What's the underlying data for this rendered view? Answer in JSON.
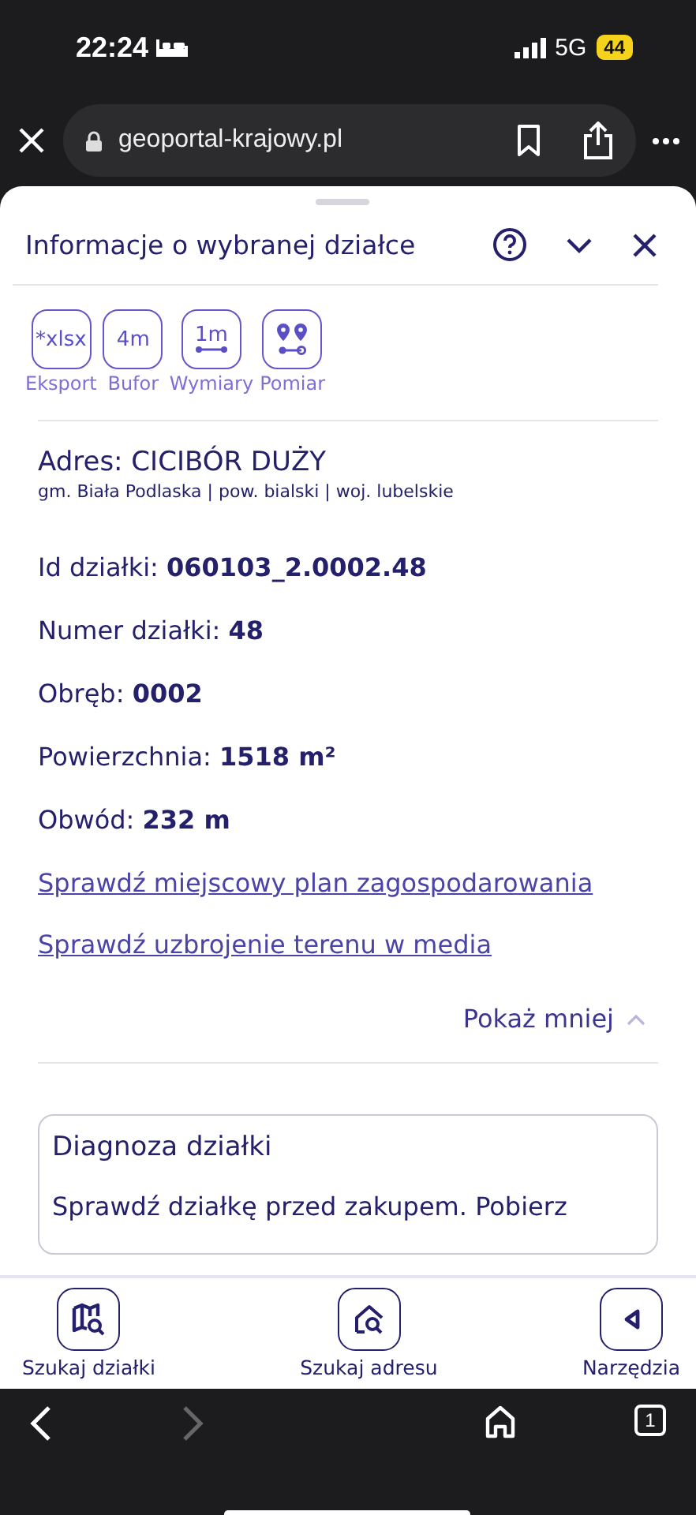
{
  "status_bar": {
    "time": "22:24",
    "network": "5G",
    "battery": "44"
  },
  "browser": {
    "url": "geoportal-krajowy.pl",
    "tab_count": "1"
  },
  "panel": {
    "title": "Informacje o wybranej działce"
  },
  "tools": [
    {
      "kind": "text",
      "icon_text": "*xlsx",
      "label": "Eksport"
    },
    {
      "kind": "text",
      "icon_text": "4m",
      "label": "Bufor"
    },
    {
      "kind": "ruler",
      "icon_text": "1m",
      "label": "Wymiary"
    },
    {
      "kind": "pins",
      "label": "Pomiar"
    }
  ],
  "address": {
    "title": "Adres: CICIBÓR DUŻY",
    "subtitle": "gm. Biała Podlaska | pow. bialski | woj. lubelskie"
  },
  "fields": [
    {
      "label": "Id działki:",
      "value": "060103_2.0002.48"
    },
    {
      "label": "Numer działki:",
      "value": "48"
    },
    {
      "label": "Obręb:",
      "value": "0002"
    },
    {
      "label": "Powierzchnia:",
      "value": "1518 m²"
    },
    {
      "label": "Obwód:",
      "value": "232 m"
    }
  ],
  "links": [
    "Sprawdź miejscowy plan zagospodarowania",
    "Sprawdź uzbrojenie terenu w media"
  ],
  "toggle": {
    "label": "Pokaż mniej",
    "expanded": true
  },
  "diagnosis": {
    "title": "Diagnoza działki",
    "text": "Sprawdź działkę przed zakupem. Pobierz"
  },
  "bottom_nav": [
    {
      "kind": "map-search",
      "label": "Szukaj działki"
    },
    {
      "kind": "house-search",
      "label": "Szukaj adresu"
    },
    {
      "kind": "triangle",
      "label": "Narzędzia"
    }
  ]
}
